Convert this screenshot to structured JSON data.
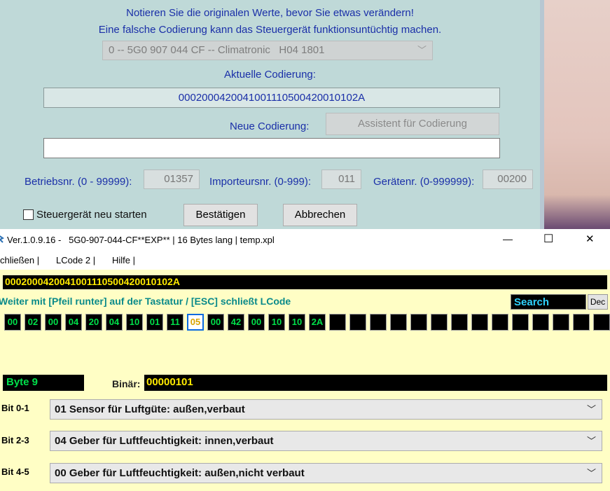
{
  "dialog": {
    "warning_line1": "Notieren Sie die originalen Werte, bevor Sie etwas verändern!",
    "warning_line2": "Eine falsche Codierung kann das Steuergerät funktionsuntüchtig machen.",
    "module_select": "0 -- 5G0 907 044 CF -- Climatronic   H04 1801",
    "current_coding_label": "Aktuelle Codierung:",
    "current_coding_value": "0002000420041001110500420010102A",
    "new_coding_label": "Neue Codierung:",
    "assistant_button": "Assistent für Codierung",
    "new_coding_value": "",
    "betriebsnr_label": "Betriebsnr. (0 - 99999):",
    "betriebsnr_value": "01357",
    "importeursnr_label": "Importeursnr. (0-999):",
    "importeursnr_value": "011",
    "geraetenr_label": "Gerätenr. (0-999999):",
    "geraetenr_value": "00200",
    "restart_checkbox_label": "Steuergerät neu starten",
    "restart_checked": false,
    "confirm_button": "Bestätigen",
    "cancel_button": "Abbrechen"
  },
  "lcode": {
    "title": "Ver.1.0.9.16 -   5G0-907-044-CF**EXP** | 16 Bytes lang | temp.xpl",
    "window_controls": {
      "minimize": "—",
      "maximize": "☐",
      "close": "✕"
    },
    "menu": [
      "chließen |",
      "LCode 2 |",
      "Hilfe |"
    ],
    "coding_string": "0002000420041001110500420010102A",
    "hint": "Weiter mit [Pfeil runter] auf der Tastatur / [ESC] schließt LCode",
    "search_label": "Search",
    "dec_label": "Dec",
    "bytes": [
      "00",
      "02",
      "00",
      "04",
      "20",
      "04",
      "10",
      "01",
      "11",
      "05",
      "00",
      "42",
      "00",
      "10",
      "10",
      "2A",
      "",
      "",
      "",
      "",
      "",
      "",
      "",
      "",
      "",
      "",
      "",
      "",
      "",
      ""
    ],
    "selected_byte_index": 9,
    "byte_label": "Byte 9",
    "binary_label": "Binär:",
    "binary_value": "00000101",
    "bits": [
      {
        "label": "Bit 0-1",
        "value": "01 Sensor für Luftgüte: außen,verbaut"
      },
      {
        "label": "Bit 2-3",
        "value": "04 Geber für Luftfeuchtigkeit: innen,verbaut"
      },
      {
        "label": "Bit 4-5",
        "value": "00 Geber für Luftfeuchtigkeit: außen,nicht verbaut"
      }
    ]
  },
  "colors": {
    "dialog_bg": "#bfd9d8",
    "label_blue": "#1a2fa8",
    "lcode_bg": "#fffec5",
    "byte_green": "#00e04a",
    "coding_yellow": "#ffea00",
    "hint_teal": "#0a8a8a"
  }
}
